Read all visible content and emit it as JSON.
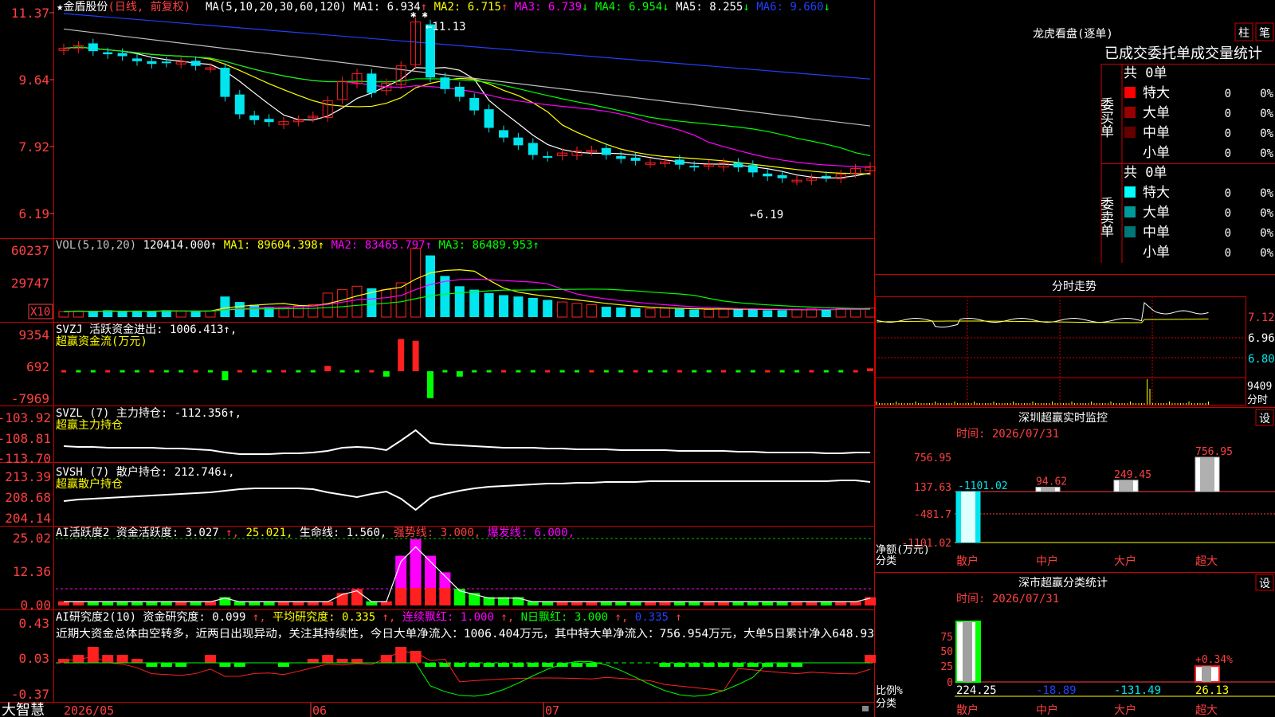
{
  "stock": {
    "star": "★",
    "name": "金盾股份",
    "mode": "(日线, 前复权)"
  },
  "colors": {
    "up": "#ff2020",
    "down": "#00e5ee",
    "frame": "#cc0000",
    "axis": "#ff4040",
    "yellow": "#ffff00",
    "magenta": "#ff00ff",
    "green": "#00ff00",
    "white": "#ffffff",
    "blue": "#2040ff",
    "gray": "#c0c0c0"
  },
  "price_panel": {
    "yticks": [
      "11.37",
      "9.64",
      "7.92",
      "6.19"
    ],
    "ma_header": {
      "label": "MA(5,10,20,30,60,120)",
      "items": [
        {
          "k": "MA1:",
          "v": "6.934",
          "a": "↑"
        },
        {
          "k": "MA2:",
          "v": "6.715",
          "a": "↑"
        },
        {
          "k": "MA3:",
          "v": "6.739",
          "a": "↓"
        },
        {
          "k": "MA4:",
          "v": "6.954",
          "a": "↓"
        },
        {
          "k": "MA5:",
          "v": "8.255",
          "a": "↓"
        },
        {
          "k": "MA6:",
          "v": "9.660",
          "a": "↓"
        }
      ]
    },
    "high_label": "←11.13",
    "low_label": "←6.19"
  },
  "vol_panel": {
    "yticks": [
      "60237",
      "29747"
    ],
    "unit": "X10",
    "header": [
      {
        "t": "VOL(5,10,20)",
        "c": "gray"
      },
      {
        "t": "120414.000↑",
        "c": "white"
      },
      {
        "t": "MA1: 89604.398↑",
        "c": "yellow"
      },
      {
        "t": "MA2: 83465.797↑",
        "c": "magenta"
      },
      {
        "t": "MA3: 86489.953↑",
        "c": "green"
      }
    ]
  },
  "svzj_panel": {
    "yticks": [
      "9354",
      "692",
      "-7969"
    ],
    "line1": "SVZJ  活跃资金进出: 1006.413↑,",
    "line2": "超赢资金流(万元)"
  },
  "svzl_panel": {
    "yticks": [
      "-103.92",
      "-108.81",
      "-113.70"
    ],
    "line1": "SVZL (7) 主力持仓: -112.356↑,",
    "line2": "超赢主力持仓"
  },
  "svsh_panel": {
    "yticks": [
      "213.39",
      "208.68",
      "204.14"
    ],
    "line1": "SVSH (7) 散户持仓: 212.746↓,",
    "line2": "超赢散户持仓"
  },
  "ai1_panel": {
    "yticks": [
      "25.02",
      "12.36",
      "0.00"
    ],
    "header": [
      {
        "t": "AI活跃度2 资金活跃度: 3.027",
        "c": "white"
      },
      {
        "t": "↑, ",
        "c": "axis"
      },
      {
        "t": "25.021,",
        "c": "yellow"
      },
      {
        "t": " 生命线: 1.560,",
        "c": "white"
      },
      {
        "t": " 强势线: 3.000,",
        "c": "axis"
      },
      {
        "t": " 爆发线: 6.000,",
        "c": "magenta"
      }
    ]
  },
  "ai2_panel": {
    "yticks": [
      "0.43",
      "0.03",
      "-0.37"
    ],
    "header": [
      {
        "t": "AI研究度2(10) 资金研究度: 0.099",
        "c": "white"
      },
      {
        "t": "↑, ",
        "c": "axis"
      },
      {
        "t": "平均研究度: 0.335",
        "c": "yellow"
      },
      {
        "t": "↑, ",
        "c": "axis"
      },
      {
        "t": "连续飘红: 1.000",
        "c": "magenta"
      },
      {
        "t": "↑, ",
        "c": "axis"
      },
      {
        "t": "N日飘红: 3.000",
        "c": "green"
      },
      {
        "t": "↑, ",
        "c": "axis"
      },
      {
        "t": "0.335",
        "c": "blue"
      },
      {
        "t": "↑",
        "c": "axis"
      }
    ],
    "note": "近期大资金总体由空转多，近两日出现异动，关注其持续性，今日大单净流入：1006.404万元，其中特大单净流入：756.954万元，大单5日累计净入648.93"
  },
  "bottom_bar": {
    "brand": "大智慧",
    "dates": [
      "2026/05",
      "06",
      "07"
    ]
  },
  "dragon": {
    "title": "龙虎看盘(逐单)",
    "btn1": "柱",
    "btn2": "笔",
    "header": "已成交委托单成交量统计",
    "buy_label": "委买单",
    "sell_label": "委卖单",
    "buy_total": "共 0单",
    "sell_total": "共 0单",
    "buy_rows": [
      {
        "label": "特大",
        "v": "0",
        "p": "0%",
        "c": "#ff0000"
      },
      {
        "label": "大单",
        "v": "0",
        "p": "0%",
        "c": "#990000"
      },
      {
        "label": "中单",
        "v": "0",
        "p": "0%",
        "c": "#660000"
      },
      {
        "label": "小单",
        "v": "0",
        "p": "0%",
        "c": ""
      }
    ],
    "sell_rows": [
      {
        "label": "特大",
        "v": "0",
        "p": "0%",
        "c": "#00ffff"
      },
      {
        "label": "大单",
        "v": "0",
        "p": "0%",
        "c": "#009999"
      },
      {
        "label": "中单",
        "v": "0",
        "p": "0%",
        "c": "#007777"
      },
      {
        "label": "小单",
        "v": "0",
        "p": "0%",
        "c": ""
      }
    ]
  },
  "intraday": {
    "title": "分时走势",
    "yticks": [
      "7.12",
      "6.96",
      "6.80"
    ],
    "vol_tick": "9409",
    "vol_label": "分时"
  },
  "monitor": {
    "title": "深圳超赢实时监控",
    "btn": "设",
    "time": "时间: 2026/07/31",
    "yticks": [
      "756.95",
      "137.63",
      "-481.7",
      "-1101.02"
    ],
    "side_labels": [
      "净额(万元)",
      "分类"
    ],
    "categories": [
      "散户",
      "中户",
      "大户",
      "超大"
    ],
    "values": [
      -1101.02,
      94.62,
      249.45,
      756.95
    ],
    "value_labels": [
      "-1101.02",
      "94.62",
      "249.45",
      "756.95"
    ]
  },
  "classify": {
    "title": "深市超赢分类统计",
    "btn": "设",
    "time": "时间: 2026/07/31",
    "yticks": [
      "75",
      "50",
      "25",
      "0"
    ],
    "side_labels": [
      "比例%",
      "分类"
    ],
    "categories": [
      "散户",
      "中户",
      "大户",
      "超大"
    ],
    "bar_pct": [
      100,
      0,
      0,
      26
    ],
    "bottom_values": [
      "224.25",
      "-18.89",
      "-131.49",
      "26.13"
    ],
    "top_label": "+0.34%"
  }
}
